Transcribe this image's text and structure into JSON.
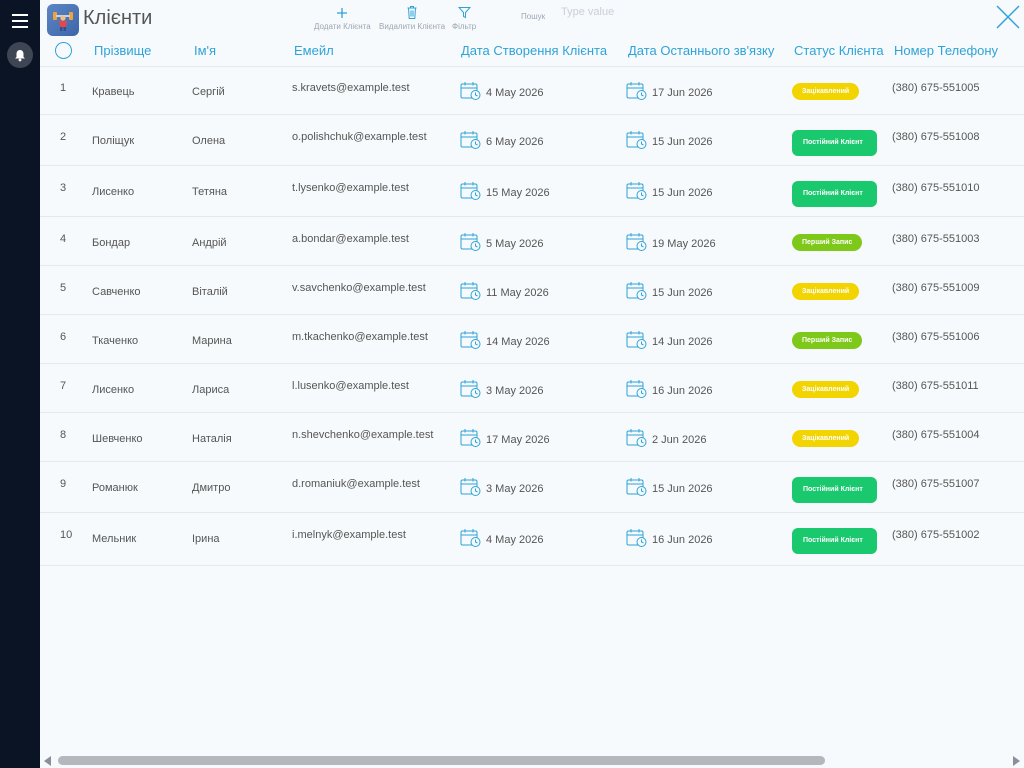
{
  "header": {
    "title": "Клієнти",
    "toolbar": {
      "add_label": "Додати Клієнта",
      "delete_label": "Видалити Клієнта",
      "filter_label": "Фільтр"
    },
    "search": {
      "label": "Пошук",
      "placeholder": "Type value",
      "value": ""
    }
  },
  "table": {
    "columns": [
      "Прізвище",
      "Ім'я",
      "Емейл",
      "Дата Створення Клієнта",
      "Дата Останнього зв'язку",
      "Статус Клієнта",
      "Номер Телефону"
    ],
    "rows": [
      {
        "num": "1",
        "surname": "Кравець",
        "name": "Сергій",
        "email": "s.kravets@example.test",
        "created": "4 May 2026",
        "last_contact": "17 Jun 2026",
        "status": "Зацікавлений",
        "status_type": "interested",
        "phone": "(380) 675-551005"
      },
      {
        "num": "2",
        "surname": "Поліщук",
        "name": "Олена",
        "email": "o.polishchuk@example.test",
        "created": "6 May 2026",
        "last_contact": "15 Jun 2026",
        "status": "Постійний Клієнт",
        "status_type": "regular",
        "phone": "(380) 675-551008"
      },
      {
        "num": "3",
        "surname": "Лисенко",
        "name": "Тетяна",
        "email": "t.lysenko@example.test",
        "created": "15 May 2026",
        "last_contact": "15 Jun 2026",
        "status": "Постійний Клієнт",
        "status_type": "regular",
        "phone": "(380) 675-551010"
      },
      {
        "num": "4",
        "surname": "Бондар",
        "name": "Андрій",
        "email": "a.bondar@example.test",
        "created": "5 May 2026",
        "last_contact": "19 May 2026",
        "status": "Перший Запис",
        "status_type": "first",
        "phone": "(380) 675-551003"
      },
      {
        "num": "5",
        "surname": "Савченко",
        "name": "Віталій",
        "email": "v.savchenko@example.test",
        "created": "11 May 2026",
        "last_contact": "15 Jun 2026",
        "status": "Зацікавлений",
        "status_type": "interested",
        "phone": "(380) 675-551009"
      },
      {
        "num": "6",
        "surname": "Ткаченко",
        "name": "Марина",
        "email": "m.tkachenko@example.test",
        "created": "14 May 2026",
        "last_contact": "14 Jun 2026",
        "status": "Перший Запис",
        "status_type": "first",
        "phone": "(380) 675-551006"
      },
      {
        "num": "7",
        "surname": "Лисенко",
        "name": "Лариса",
        "email": "l.lusenko@example.test",
        "created": "3 May 2026",
        "last_contact": "16 Jun 2026",
        "status": "Зацікавлений",
        "status_type": "interested",
        "phone": "(380) 675-551011"
      },
      {
        "num": "8",
        "surname": "Шевченко",
        "name": "Наталія",
        "email": "n.shevchenko@example.test",
        "created": "17 May 2026",
        "last_contact": "2 Jun 2026",
        "status": "Зацікавлений",
        "status_type": "interested",
        "phone": "(380) 675-551004"
      },
      {
        "num": "9",
        "surname": "Романюк",
        "name": "Дмитро",
        "email": "d.romaniuk@example.test",
        "created": "3 May 2026",
        "last_contact": "15 Jun 2026",
        "status": "Постійний Клієнт",
        "status_type": "regular",
        "phone": "(380) 675-551007"
      },
      {
        "num": "10",
        "surname": "Мельник",
        "name": "Ірина",
        "email": "i.melnyk@example.test",
        "created": "4 May 2026",
        "last_contact": "16 Jun 2026",
        "status": "Постійний Клієнт",
        "status_type": "regular",
        "phone": "(380) 675-551002"
      }
    ]
  },
  "colors": {
    "accent": "#2ea3d8",
    "sidebar": "#0b1424",
    "status_interested": "#f2d400",
    "status_regular": "#1ac86e",
    "status_first": "#7ec81a"
  },
  "icons": {
    "sidebar": [
      "menu-icon",
      "bell-icon"
    ],
    "toolbar": [
      "plus-icon",
      "trash-icon",
      "filter-icon"
    ],
    "window": [
      "close-icon"
    ],
    "cells": [
      "calendar-clock-icon"
    ],
    "scroll": [
      "scroll-left-arrow-icon",
      "scroll-right-arrow-icon"
    ]
  }
}
